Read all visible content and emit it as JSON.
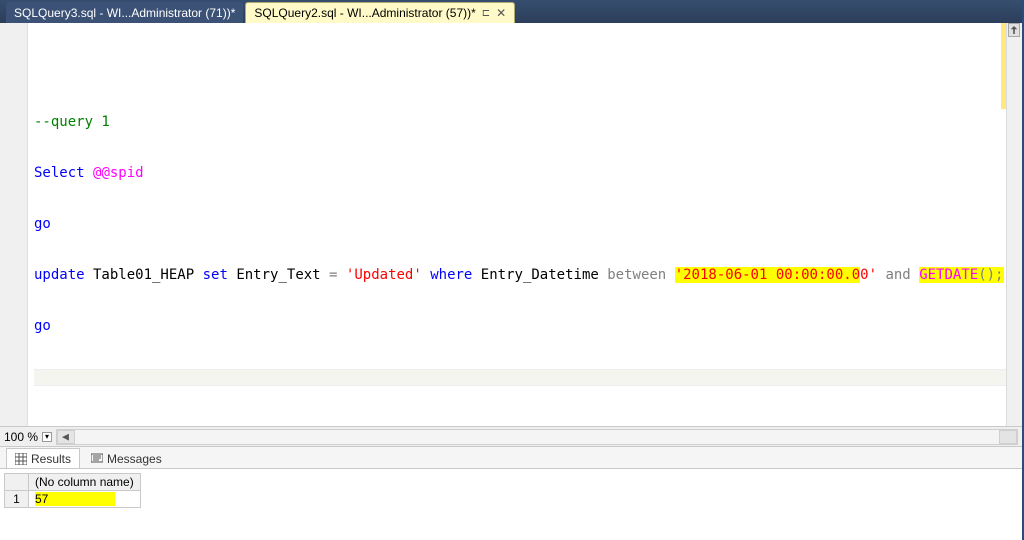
{
  "tabs": [
    {
      "label": "SQLQuery3.sql - WI...Administrator (71))*",
      "active": false
    },
    {
      "label": "SQLQuery2.sql - WI...Administrator (57))*",
      "active": true
    }
  ],
  "editor": {
    "lines": {
      "l1_comment": "--query 1",
      "l2_select": "Select",
      "l2_spid": "@@spid",
      "l3_go": "go",
      "l4_update": "update",
      "l4_table": " Table01_HEAP ",
      "l4_set": "set",
      "l4_col": " Entry_Text ",
      "l4_eq": "=",
      "l4_str": "'Updated'",
      "l4_where": "where",
      "l4_col2": " Entry_Datetime ",
      "l4_between": "between",
      "l4_date_q1": "'",
      "l4_date_body": "2018-06-01 00:00:00.0",
      "l4_date_tail": "0",
      "l4_date_q2": "'",
      "l4_and": "and",
      "l4_func": "GETDATE",
      "l4_paren": "();",
      "l5_go": "go"
    }
  },
  "status": {
    "zoom": "100 %"
  },
  "results_tabs": {
    "results": "Results",
    "messages": "Messages"
  },
  "results": {
    "col_header": "(No column name)",
    "row_num": "1",
    "value": "57"
  }
}
